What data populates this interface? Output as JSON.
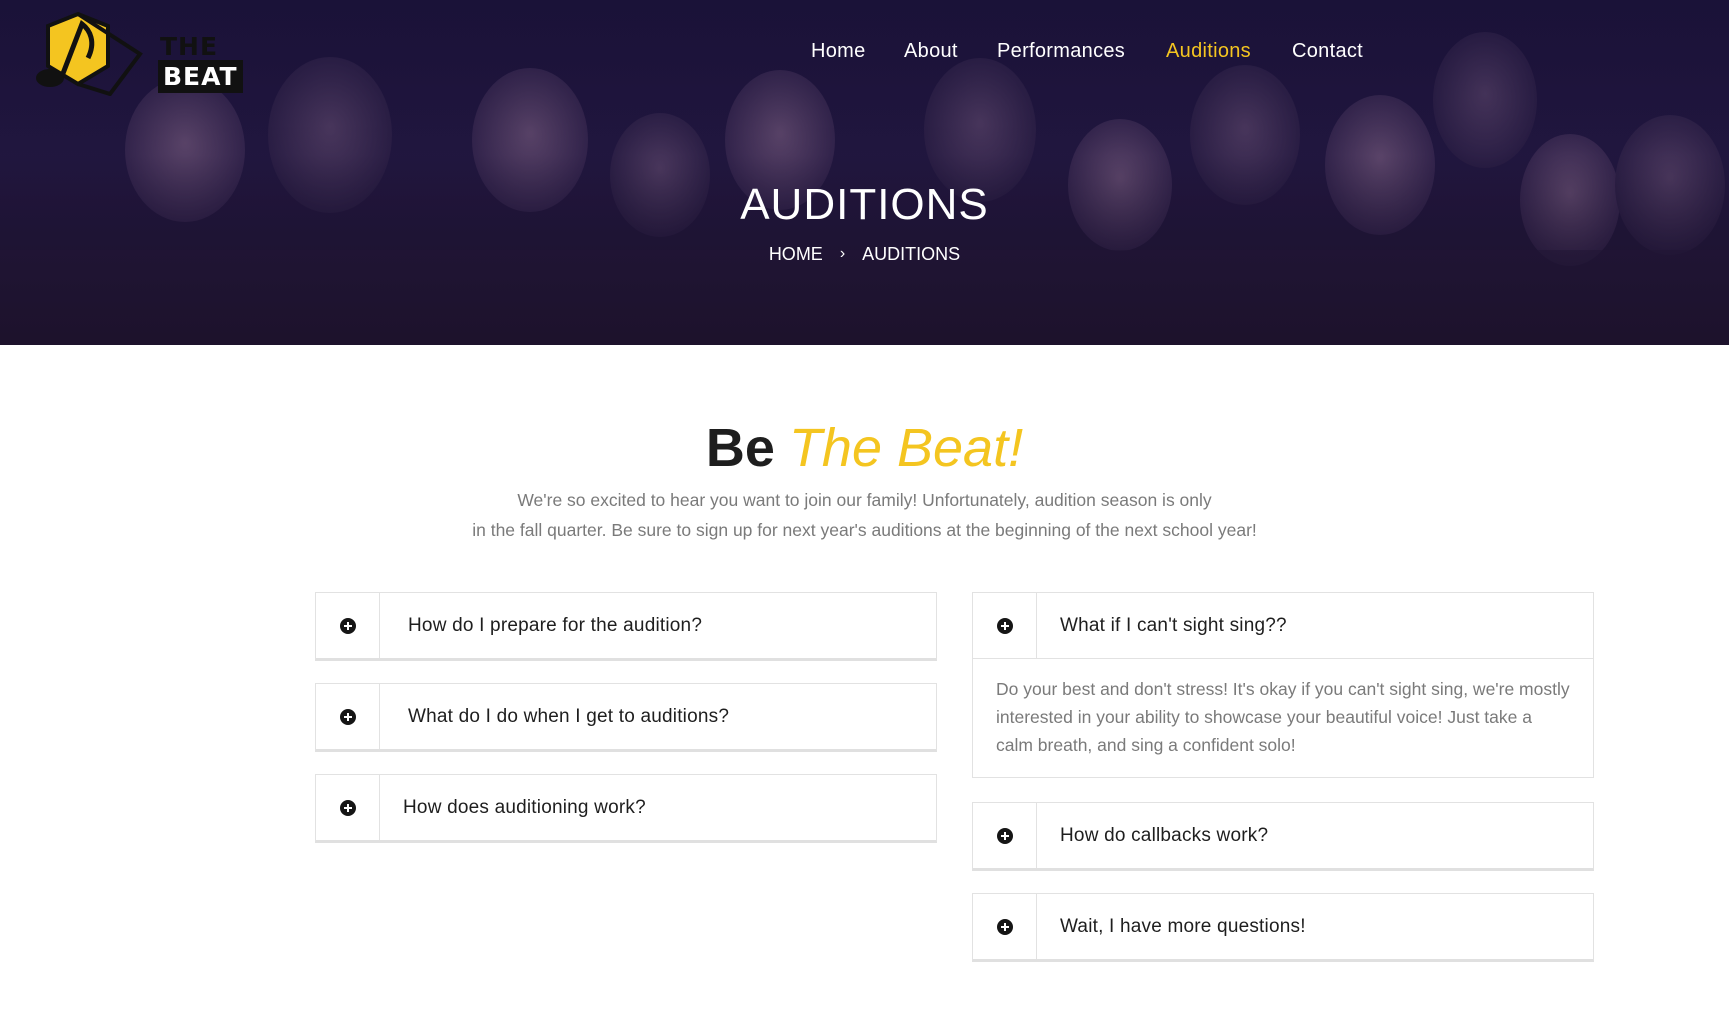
{
  "brand": {
    "logo_line1": "THE",
    "logo_line2": "BEAT",
    "accent_color": "#f4c520"
  },
  "nav": {
    "items": [
      {
        "label": "Home"
      },
      {
        "label": "About"
      },
      {
        "label": "Performances"
      },
      {
        "label": "Auditions",
        "active": true
      },
      {
        "label": "Contact"
      }
    ]
  },
  "hero": {
    "title": "AUDITIONS",
    "breadcrumb": {
      "home": "HOME",
      "separator": "›",
      "current": "AUDITIONS"
    }
  },
  "section": {
    "heading_plain": "Be",
    "heading_accent": "The Beat!",
    "intro_line1": "We're so excited to hear you want to join our family! Unfortunately, audition season is only",
    "intro_line2": "in the fall quarter. Be sure to sign up for next year's auditions at the beginning of the next school year!"
  },
  "faq_left": [
    {
      "question": "How do I prepare for the audition?"
    },
    {
      "question": "What do I do when I get to auditions?"
    },
    {
      "question": "How does auditioning work?"
    }
  ],
  "faq_right": [
    {
      "question": "What if I can't sight sing??",
      "answer": "Do your best and don't stress! It's okay if you can't sight sing, we're mostly interested in your ability to showcase your beautiful voice! Just take a calm breath, and sing a confident solo!"
    },
    {
      "question": "How do callbacks work?"
    },
    {
      "question": "Wait, I have more questions!"
    }
  ]
}
